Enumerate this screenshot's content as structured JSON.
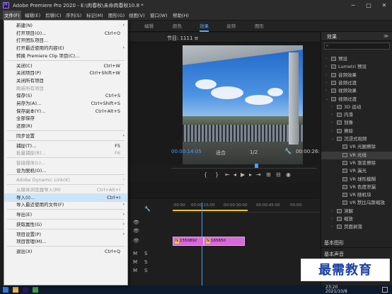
{
  "window": {
    "title": "Adobe Premiere Pro 2020 - E:\\肉春秋\\未命肉春秋10.8 *",
    "min": "─",
    "max": "□",
    "close": "✕"
  },
  "menubar": [
    "文件(F)",
    "编辑(E)",
    "剪辑(C)",
    "序列(S)",
    "标记(M)",
    "图形(G)",
    "视图(V)",
    "窗口(W)",
    "帮助(H)"
  ],
  "workspaces": [
    "编辑",
    "颜色",
    "效果",
    "音频",
    "图形"
  ],
  "program": {
    "label": "节目: 1111 ≡",
    "tc_left": "00:00:14:05",
    "fit": "适合",
    "res": "1/2",
    "tc_right": "00:00:26:"
  },
  "timeline": {
    "ticks": [
      ":00:00",
      "00:00:15:00",
      "00:00:30:00",
      "00:00:45:00",
      "00:00:"
    ],
    "clips": [
      "1550892",
      "165650"
    ],
    "fx": "fx"
  },
  "effects": {
    "title": "效果",
    "items": [
      {
        "label": "预设",
        "level": 1,
        "icon": false
      },
      {
        "label": "Lumetri 预设",
        "level": 1,
        "icon": false
      },
      {
        "label": "音频效果",
        "level": 1,
        "icon": false
      },
      {
        "label": "音频过渡",
        "level": 1,
        "icon": false
      },
      {
        "label": "视频效果",
        "level": 1,
        "icon": false
      },
      {
        "label": "视频过渡",
        "level": 1,
        "icon": false
      },
      {
        "label": "3D 运动",
        "level": 2,
        "icon": false
      },
      {
        "label": "内滑",
        "level": 2,
        "icon": false
      },
      {
        "label": "划像",
        "level": 2,
        "icon": false
      },
      {
        "label": "擦除",
        "level": 2,
        "icon": false
      },
      {
        "label": "沉浸式视频",
        "level": 2,
        "icon": false
      },
      {
        "label": "VR 光圈擦除",
        "level": 3,
        "icon": true
      },
      {
        "label": "VR 光线",
        "level": 3,
        "icon": true
      },
      {
        "label": "VR 渐变擦除",
        "level": 3,
        "icon": true
      },
      {
        "label": "VR 漏光",
        "level": 3,
        "icon": true
      },
      {
        "label": "VR 球形模糊",
        "level": 3,
        "icon": true
      },
      {
        "label": "VR 色度泄漏",
        "level": 3,
        "icon": true
      },
      {
        "label": "VR 随机块",
        "level": 3,
        "icon": true
      },
      {
        "label": "VR 默比乌斯缩放",
        "level": 3,
        "icon": true
      },
      {
        "label": "溶解",
        "level": 2,
        "icon": false
      },
      {
        "label": "缩放",
        "level": 2,
        "icon": false
      },
      {
        "label": "页面剥落",
        "level": 2,
        "icon": false
      }
    ],
    "basic_graphics": "基本图形",
    "basic_sound": "基本声音"
  },
  "file_menu": [
    {
      "label": "新建(N)",
      "shortcut": "",
      "sub": true,
      "disabled": false
    },
    {
      "label": "打开项目(O)...",
      "shortcut": "Ctrl+O",
      "sub": false,
      "disabled": false
    },
    {
      "label": "打开团队项目...",
      "shortcut": "",
      "sub": false,
      "disabled": false
    },
    {
      "label": "打开最近使用的内容(E)",
      "shortcut": "",
      "sub": true,
      "disabled": false
    },
    {
      "label": "转换 Premiere Clip 项目(C)...",
      "shortcut": "",
      "sub": false,
      "disabled": false
    },
    {
      "sep": true
    },
    {
      "label": "关闭(C)",
      "shortcut": "Ctrl+W",
      "sub": false,
      "disabled": false
    },
    {
      "label": "关闭项目(P)",
      "shortcut": "Ctrl+Shift+W",
      "sub": false,
      "disabled": false
    },
    {
      "label": "关闭所有项目",
      "shortcut": "",
      "sub": false,
      "disabled": false
    },
    {
      "label": "刷新所有项目",
      "shortcut": "",
      "sub": false,
      "disabled": true
    },
    {
      "label": "保存(S)",
      "shortcut": "Ctrl+S",
      "sub": false,
      "disabled": false
    },
    {
      "label": "另存为(A)...",
      "shortcut": "Ctrl+Shift+S",
      "sub": false,
      "disabled": false
    },
    {
      "label": "保存副本(Y)...",
      "shortcut": "Ctrl+Alt+S",
      "sub": false,
      "disabled": false
    },
    {
      "label": "全部保存",
      "shortcut": "",
      "sub": false,
      "disabled": false
    },
    {
      "label": "还原(R)",
      "shortcut": "",
      "sub": false,
      "disabled": false
    },
    {
      "sep": true
    },
    {
      "label": "同步设置",
      "shortcut": "",
      "sub": true,
      "disabled": false
    },
    {
      "sep": true
    },
    {
      "label": "捕捉(T)...",
      "shortcut": "F5",
      "sub": false,
      "disabled": false
    },
    {
      "label": "批量捕捉(B)...",
      "shortcut": "F6",
      "sub": false,
      "disabled": true
    },
    {
      "sep": true
    },
    {
      "label": "链接媒体(L)...",
      "shortcut": "",
      "sub": false,
      "disabled": true
    },
    {
      "label": "设为脱机(O)...",
      "shortcut": "",
      "sub": false,
      "disabled": false
    },
    {
      "sep": true
    },
    {
      "label": "Adobe Dynamic Link(K)",
      "shortcut": "",
      "sub": true,
      "disabled": true
    },
    {
      "sep": true
    },
    {
      "label": "从媒体浏览器导入(M)",
      "shortcut": "Ctrl+Alt+I",
      "sub": false,
      "disabled": true
    },
    {
      "label": "导入(I)...",
      "shortcut": "Ctrl+I",
      "sub": false,
      "disabled": false,
      "highlight": true
    },
    {
      "label": "导入最近使用的文件(F)",
      "shortcut": "",
      "sub": true,
      "disabled": false
    },
    {
      "sep": true
    },
    {
      "label": "导出(E)",
      "shortcut": "",
      "sub": true,
      "disabled": false
    },
    {
      "sep": true
    },
    {
      "label": "获取属性(G)",
      "shortcut": "",
      "sub": true,
      "disabled": false
    },
    {
      "sep": true
    },
    {
      "label": "项目设置(P)",
      "shortcut": "",
      "sub": true,
      "disabled": false
    },
    {
      "label": "项目管理(M)...",
      "shortcut": "",
      "sub": false,
      "disabled": false
    },
    {
      "sep": true
    },
    {
      "label": "退出(X)",
      "shortcut": "Ctrl+Q",
      "sub": false,
      "disabled": false
    }
  ],
  "watermark": "最需教育",
  "taskbar": {
    "time": "23:20",
    "date": "2021/10/8"
  }
}
